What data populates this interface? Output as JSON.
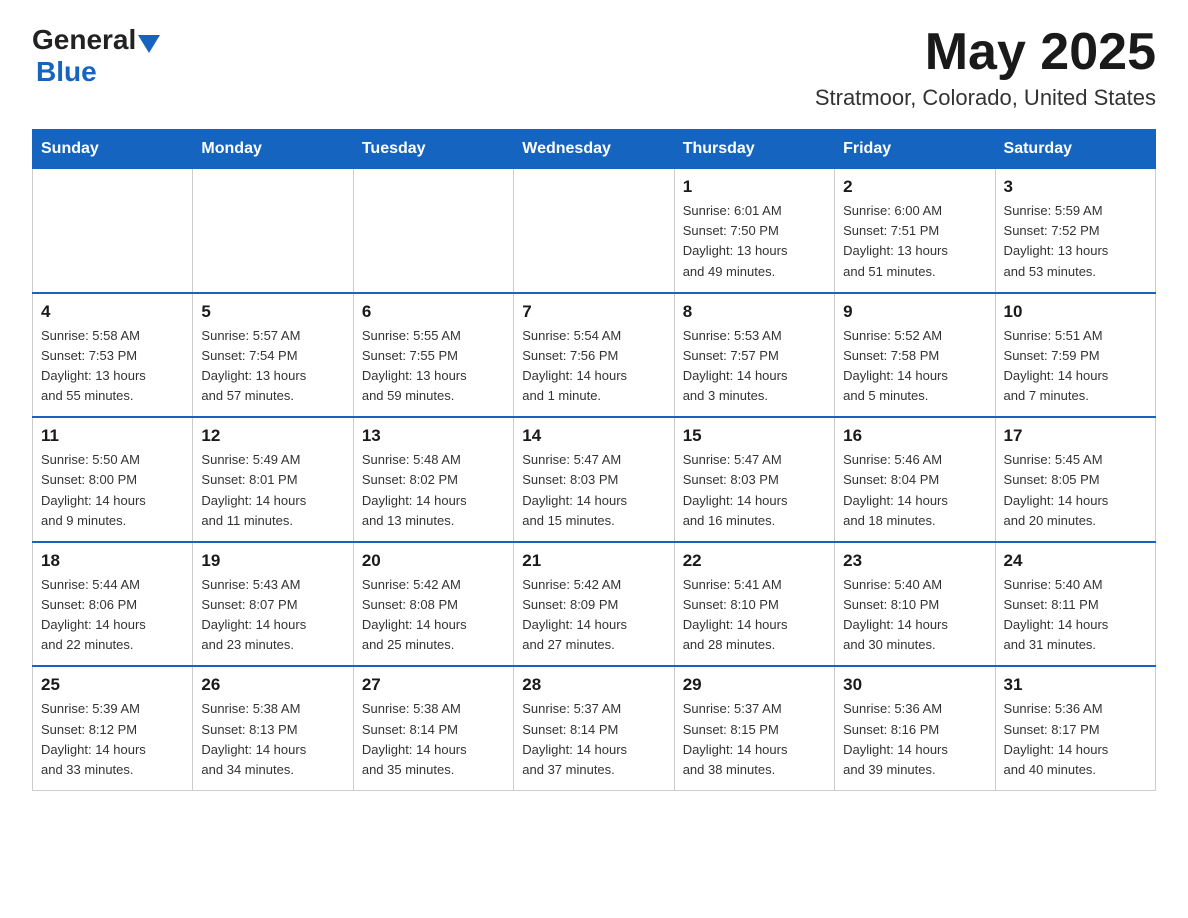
{
  "logo": {
    "text_general": "General",
    "text_blue": "Blue"
  },
  "title": {
    "month_year": "May 2025",
    "location": "Stratmoor, Colorado, United States"
  },
  "headers": [
    "Sunday",
    "Monday",
    "Tuesday",
    "Wednesday",
    "Thursday",
    "Friday",
    "Saturday"
  ],
  "weeks": [
    [
      {
        "day": "",
        "info": ""
      },
      {
        "day": "",
        "info": ""
      },
      {
        "day": "",
        "info": ""
      },
      {
        "day": "",
        "info": ""
      },
      {
        "day": "1",
        "info": "Sunrise: 6:01 AM\nSunset: 7:50 PM\nDaylight: 13 hours\nand 49 minutes."
      },
      {
        "day": "2",
        "info": "Sunrise: 6:00 AM\nSunset: 7:51 PM\nDaylight: 13 hours\nand 51 minutes."
      },
      {
        "day": "3",
        "info": "Sunrise: 5:59 AM\nSunset: 7:52 PM\nDaylight: 13 hours\nand 53 minutes."
      }
    ],
    [
      {
        "day": "4",
        "info": "Sunrise: 5:58 AM\nSunset: 7:53 PM\nDaylight: 13 hours\nand 55 minutes."
      },
      {
        "day": "5",
        "info": "Sunrise: 5:57 AM\nSunset: 7:54 PM\nDaylight: 13 hours\nand 57 minutes."
      },
      {
        "day": "6",
        "info": "Sunrise: 5:55 AM\nSunset: 7:55 PM\nDaylight: 13 hours\nand 59 minutes."
      },
      {
        "day": "7",
        "info": "Sunrise: 5:54 AM\nSunset: 7:56 PM\nDaylight: 14 hours\nand 1 minute."
      },
      {
        "day": "8",
        "info": "Sunrise: 5:53 AM\nSunset: 7:57 PM\nDaylight: 14 hours\nand 3 minutes."
      },
      {
        "day": "9",
        "info": "Sunrise: 5:52 AM\nSunset: 7:58 PM\nDaylight: 14 hours\nand 5 minutes."
      },
      {
        "day": "10",
        "info": "Sunrise: 5:51 AM\nSunset: 7:59 PM\nDaylight: 14 hours\nand 7 minutes."
      }
    ],
    [
      {
        "day": "11",
        "info": "Sunrise: 5:50 AM\nSunset: 8:00 PM\nDaylight: 14 hours\nand 9 minutes."
      },
      {
        "day": "12",
        "info": "Sunrise: 5:49 AM\nSunset: 8:01 PM\nDaylight: 14 hours\nand 11 minutes."
      },
      {
        "day": "13",
        "info": "Sunrise: 5:48 AM\nSunset: 8:02 PM\nDaylight: 14 hours\nand 13 minutes."
      },
      {
        "day": "14",
        "info": "Sunrise: 5:47 AM\nSunset: 8:03 PM\nDaylight: 14 hours\nand 15 minutes."
      },
      {
        "day": "15",
        "info": "Sunrise: 5:47 AM\nSunset: 8:03 PM\nDaylight: 14 hours\nand 16 minutes."
      },
      {
        "day": "16",
        "info": "Sunrise: 5:46 AM\nSunset: 8:04 PM\nDaylight: 14 hours\nand 18 minutes."
      },
      {
        "day": "17",
        "info": "Sunrise: 5:45 AM\nSunset: 8:05 PM\nDaylight: 14 hours\nand 20 minutes."
      }
    ],
    [
      {
        "day": "18",
        "info": "Sunrise: 5:44 AM\nSunset: 8:06 PM\nDaylight: 14 hours\nand 22 minutes."
      },
      {
        "day": "19",
        "info": "Sunrise: 5:43 AM\nSunset: 8:07 PM\nDaylight: 14 hours\nand 23 minutes."
      },
      {
        "day": "20",
        "info": "Sunrise: 5:42 AM\nSunset: 8:08 PM\nDaylight: 14 hours\nand 25 minutes."
      },
      {
        "day": "21",
        "info": "Sunrise: 5:42 AM\nSunset: 8:09 PM\nDaylight: 14 hours\nand 27 minutes."
      },
      {
        "day": "22",
        "info": "Sunrise: 5:41 AM\nSunset: 8:10 PM\nDaylight: 14 hours\nand 28 minutes."
      },
      {
        "day": "23",
        "info": "Sunrise: 5:40 AM\nSunset: 8:10 PM\nDaylight: 14 hours\nand 30 minutes."
      },
      {
        "day": "24",
        "info": "Sunrise: 5:40 AM\nSunset: 8:11 PM\nDaylight: 14 hours\nand 31 minutes."
      }
    ],
    [
      {
        "day": "25",
        "info": "Sunrise: 5:39 AM\nSunset: 8:12 PM\nDaylight: 14 hours\nand 33 minutes."
      },
      {
        "day": "26",
        "info": "Sunrise: 5:38 AM\nSunset: 8:13 PM\nDaylight: 14 hours\nand 34 minutes."
      },
      {
        "day": "27",
        "info": "Sunrise: 5:38 AM\nSunset: 8:14 PM\nDaylight: 14 hours\nand 35 minutes."
      },
      {
        "day": "28",
        "info": "Sunrise: 5:37 AM\nSunset: 8:14 PM\nDaylight: 14 hours\nand 37 minutes."
      },
      {
        "day": "29",
        "info": "Sunrise: 5:37 AM\nSunset: 8:15 PM\nDaylight: 14 hours\nand 38 minutes."
      },
      {
        "day": "30",
        "info": "Sunrise: 5:36 AM\nSunset: 8:16 PM\nDaylight: 14 hours\nand 39 minutes."
      },
      {
        "day": "31",
        "info": "Sunrise: 5:36 AM\nSunset: 8:17 PM\nDaylight: 14 hours\nand 40 minutes."
      }
    ]
  ]
}
